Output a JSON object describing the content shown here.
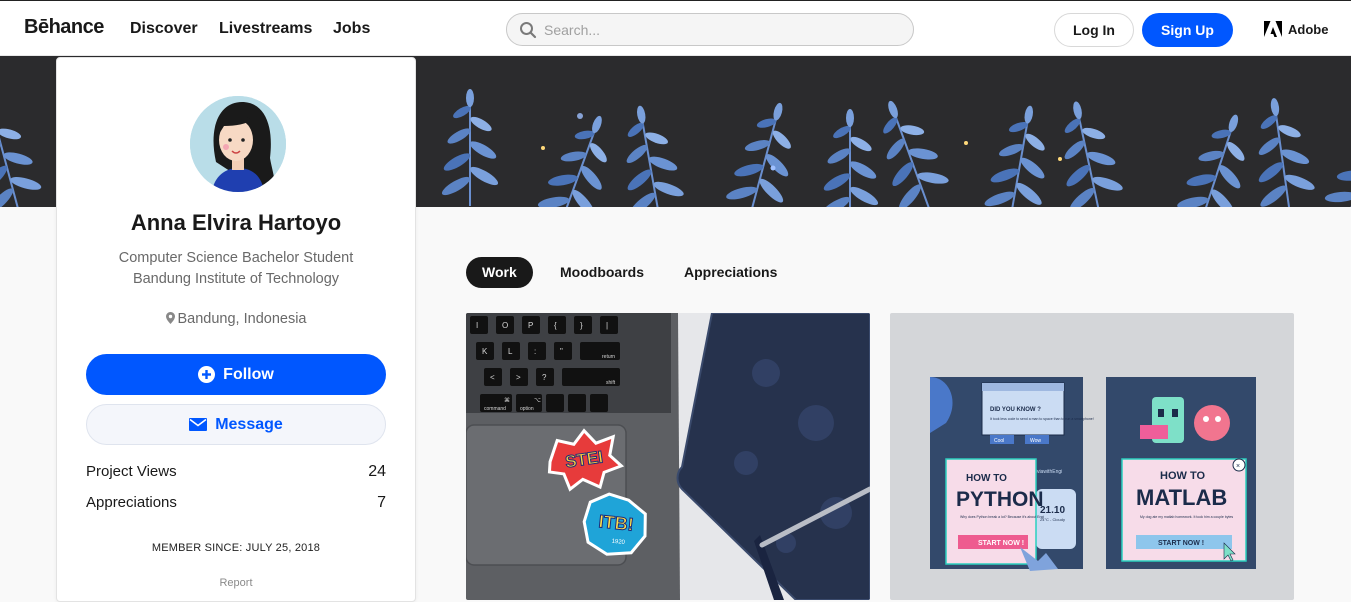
{
  "nav": {
    "logo": "Bēhance",
    "links": [
      "Discover",
      "Livestreams",
      "Jobs"
    ],
    "search_placeholder": "Search...",
    "login": "Log In",
    "signup": "Sign Up",
    "adobe": "Adobe"
  },
  "profile": {
    "name": "Anna Elvira Hartoyo",
    "occupation_line1": "Computer Science Bachelor Student",
    "occupation_line2": "Bandung Institute of Technology",
    "location": "Bandung, Indonesia",
    "follow_label": "Follow",
    "message_label": "Message",
    "stats": [
      {
        "label": "Project Views",
        "value": "24"
      },
      {
        "label": "Appreciations",
        "value": "7"
      }
    ],
    "member_since": "MEMBER SINCE: JULY 25, 2018",
    "report": "Report"
  },
  "tabs": [
    "Work",
    "Moodboards",
    "Appreciations"
  ],
  "projects": [
    {
      "name": "laptop-stickers",
      "keys_row1": [
        "I",
        "O",
        "P",
        "{",
        "}",
        "|"
      ],
      "keys_row2": [
        "K",
        "L",
        ":",
        "\"",
        "return"
      ],
      "keys_row3": [
        "<",
        ">",
        "?",
        "shift"
      ],
      "keys_row4": [
        "⌘",
        "⌥",
        "command",
        "option"
      ],
      "sticker1": "STEI",
      "sticker2": "ITB!",
      "sticker2_sub": "1920"
    },
    {
      "name": "how-to-posters",
      "poster1": {
        "title_small": "HOW TO",
        "title_big": "PYTHON",
        "caption": "Why does Python break a lot? Because it's about Engi",
        "button": "START NOW !",
        "popup_heading": "DID YOU KNOW ?",
        "popup_text": "It took less code to send a man to space than to run a smartphone!",
        "popup_btn1": "Cool",
        "popup_btn2": "Wow",
        "hashtag": "#triviawithEngi",
        "clock": "21.10",
        "weather": "24°C - Cloudy"
      },
      "poster2": {
        "title_small": "HOW TO",
        "title_big": "MATLAB",
        "caption": "My dog ate my matlab homework. It took him a couple bytes",
        "button": "START NOW !"
      }
    }
  ],
  "colors": {
    "accent": "#0057ff",
    "banner_bg": "#2b2b2d",
    "leaf": "#5b83c4",
    "poster_bg": "#33496b"
  }
}
